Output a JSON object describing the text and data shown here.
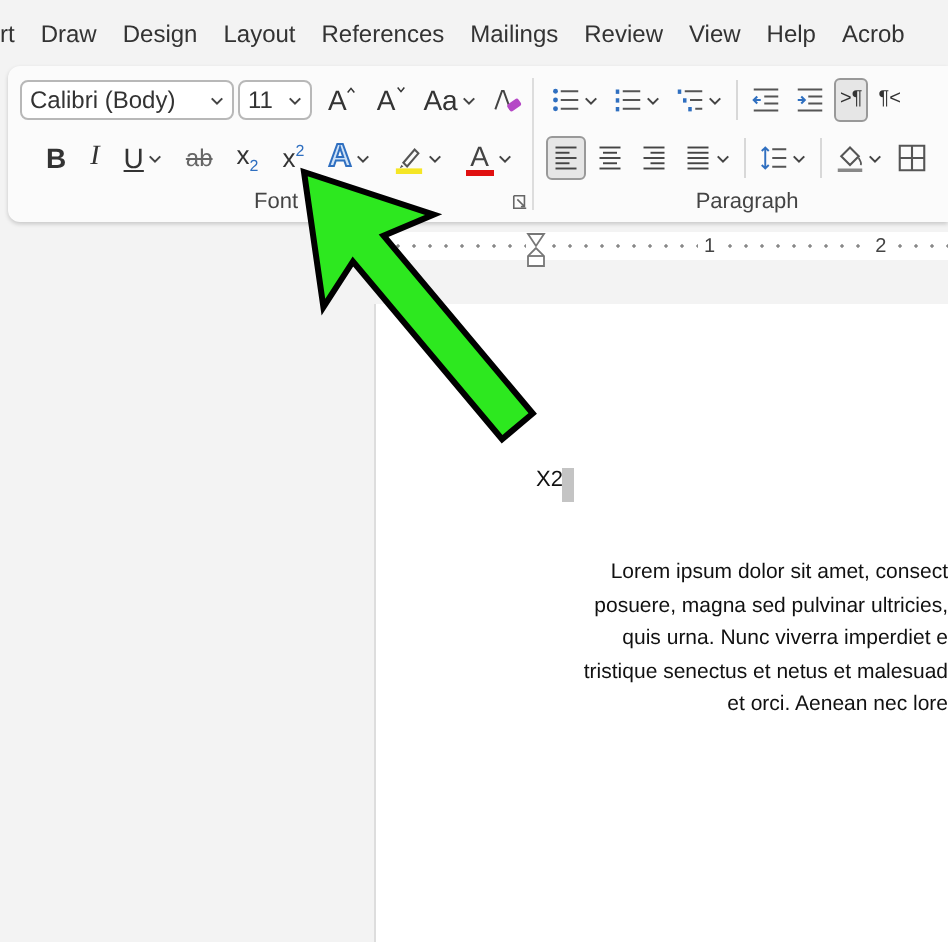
{
  "tabs": [
    {
      "label": "rt"
    },
    {
      "label": "Draw"
    },
    {
      "label": "Design"
    },
    {
      "label": "Layout"
    },
    {
      "label": "References"
    },
    {
      "label": "Mailings"
    },
    {
      "label": "Review"
    },
    {
      "label": "View"
    },
    {
      "label": "Help"
    },
    {
      "label": "Acrob"
    }
  ],
  "font_group": {
    "label": "Font",
    "font_name": "Calibri (Body)",
    "font_size": "11",
    "row1": [
      {
        "kind": "grow",
        "label": "A"
      },
      {
        "kind": "shrink",
        "label": "A"
      },
      {
        "kind": "change-case",
        "label": "Aa",
        "dropdown": true
      },
      {
        "kind": "clear-format"
      }
    ],
    "row2": [
      {
        "kind": "bold",
        "label": "B"
      },
      {
        "kind": "italic",
        "label": "I"
      },
      {
        "kind": "underline",
        "label": "U",
        "dropdown": true
      },
      {
        "kind": "strikethrough",
        "label": "ab"
      },
      {
        "kind": "subscript",
        "label": "x$_{2}$"
      },
      {
        "kind": "superscript",
        "label": "x$^{2}$"
      },
      {
        "kind": "text-effects",
        "label": "A",
        "dropdown": true
      },
      {
        "kind": "highlight",
        "dropdown": true
      },
      {
        "kind": "font-color",
        "label": "A",
        "dropdown": true
      }
    ]
  },
  "paragraph_group": {
    "label": "Paragraph",
    "row1": [
      {
        "kind": "bullets",
        "dropdown": true,
        "selected": false
      },
      {
        "kind": "numbering",
        "dropdown": true,
        "selected": false
      },
      {
        "kind": "multilevel",
        "dropdown": true,
        "selected": false
      },
      {
        "kind": "separator"
      },
      {
        "kind": "outdent",
        "selected": false
      },
      {
        "kind": "indent",
        "selected": false
      },
      {
        "kind": "ltr",
        "label": ">¶",
        "selected": true
      },
      {
        "kind": "rtl",
        "label": "¶<",
        "selected": false
      }
    ],
    "row2": [
      {
        "kind": "align-left",
        "selected": true
      },
      {
        "kind": "center",
        "selected": false
      },
      {
        "kind": "align-right",
        "selected": false
      },
      {
        "kind": "justify",
        "dropdown": true,
        "selected": false
      },
      {
        "kind": "separator"
      },
      {
        "kind": "line-spacing",
        "dropdown": true,
        "selected": false
      },
      {
        "kind": "separator"
      },
      {
        "kind": "shading",
        "dropdown": true,
        "selected": false
      },
      {
        "kind": "borders",
        "selected": false
      }
    ]
  },
  "ruler": {
    "labels": [
      "1",
      "2"
    ]
  },
  "document": {
    "typed": "X2",
    "paragraph_lines": [
      "Lorem ipsum dolor sit amet, consect",
      "posuere, magna sed pulvinar ultricies,",
      "quis urna. Nunc viverra imperdiet e",
      "tristique senectus et netus et malesuad",
      "et orci. Aenean nec lore"
    ]
  }
}
